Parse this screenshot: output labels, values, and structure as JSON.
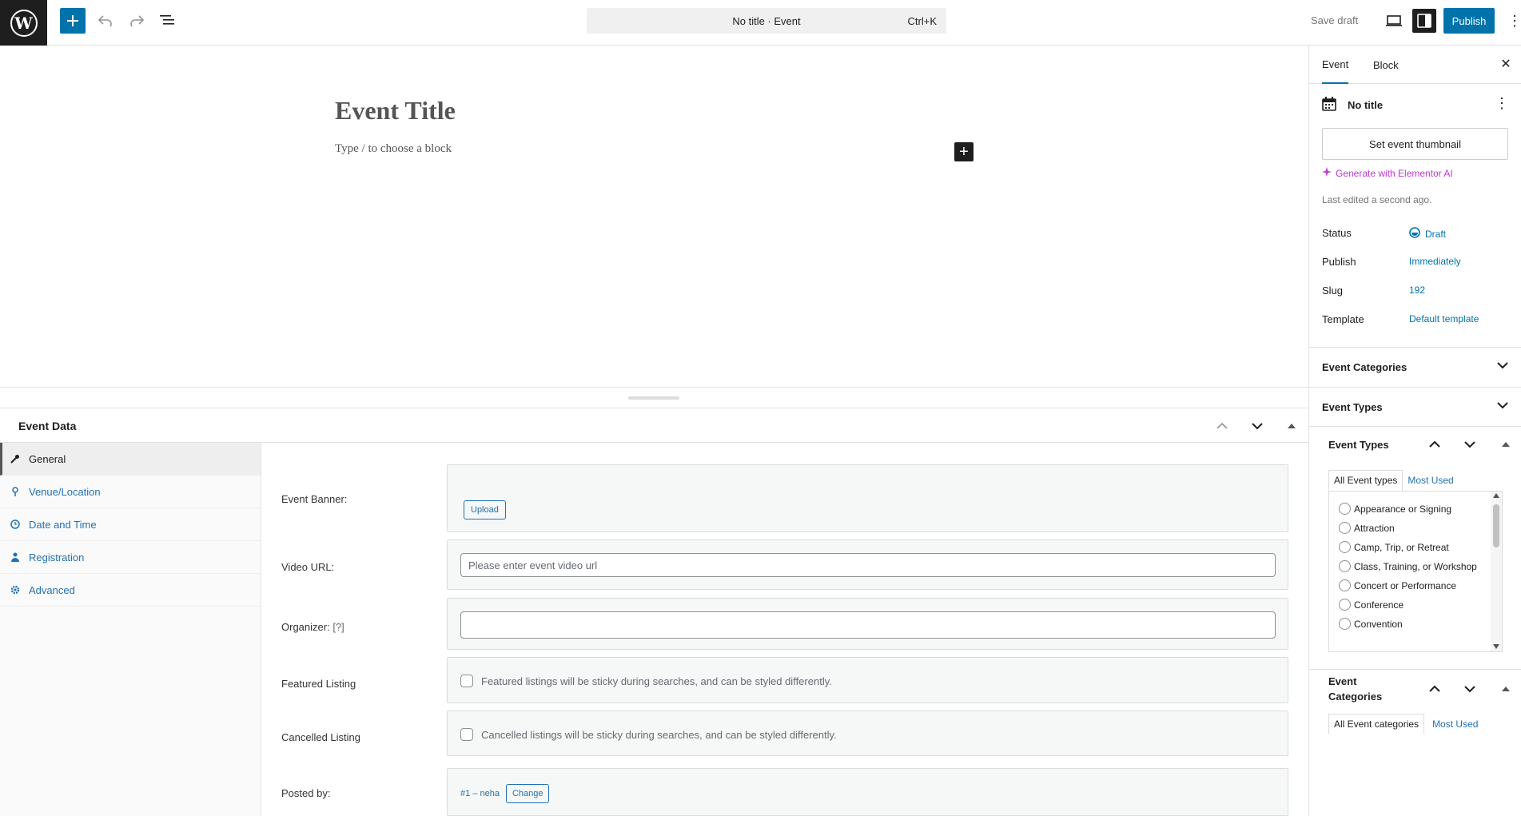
{
  "topbar": {
    "command_title": "No title · Event",
    "command_shortcut": "Ctrl+K",
    "save_draft": "Save draft",
    "publish": "Publish"
  },
  "editor": {
    "title": "Event Title",
    "placeholder": "Type / to choose a block"
  },
  "metabox": {
    "title": "Event Data",
    "tabs": [
      {
        "label": "General",
        "icon": "wrench-icon"
      },
      {
        "label": "Venue/Location",
        "icon": "location-pin-icon"
      },
      {
        "label": "Date and Time",
        "icon": "clock-icon"
      },
      {
        "label": "Registration",
        "icon": "person-icon"
      },
      {
        "label": "Advanced",
        "icon": "gear-icon"
      }
    ],
    "fields": {
      "banner_label": "Event Banner:",
      "upload": "Upload",
      "video_label": "Video URL:",
      "video_placeholder": "Please enter event video url",
      "organizer_label": "Organizer:",
      "organizer_help": "[?]",
      "featured_label": "Featured Listing",
      "featured_text": "Featured listings will be sticky during searches, and can be styled differently.",
      "cancelled_label": "Cancelled Listing",
      "cancelled_text": "Cancelled listings will be sticky during searches, and can be styled differently.",
      "posted_label": "Posted by:",
      "posted_value": "#1 – neha",
      "change": "Change"
    }
  },
  "sidebar": {
    "tabs": [
      "Event",
      "Block"
    ],
    "post_title": "No title",
    "thumbnail_button": "Set event thumbnail",
    "ai_link": "Generate with Elementor AI",
    "last_edited": "Last edited a second ago.",
    "meta": [
      {
        "key": "Status",
        "value": "Draft"
      },
      {
        "key": "Publish",
        "value": "Immediately"
      },
      {
        "key": "Slug",
        "value": "192"
      },
      {
        "key": "Template",
        "value": "Default template"
      }
    ],
    "panels": [
      "Event Categories",
      "Event Types"
    ],
    "types_box": {
      "title": "Event Types",
      "tabs": [
        "All Event types",
        "Most Used"
      ],
      "items": [
        "Appearance or Signing",
        "Attraction",
        "Camp, Trip, or Retreat",
        "Class, Training, or Workshop",
        "Concert or Performance",
        "Conference",
        "Convention"
      ]
    },
    "cats_box": {
      "title": "Event Categories",
      "tabs": [
        "All Event categories",
        "Most Used"
      ]
    }
  },
  "colors": {
    "accent": "#0073aa",
    "ai": "#c036d2",
    "dark": "#1e1e1e"
  }
}
